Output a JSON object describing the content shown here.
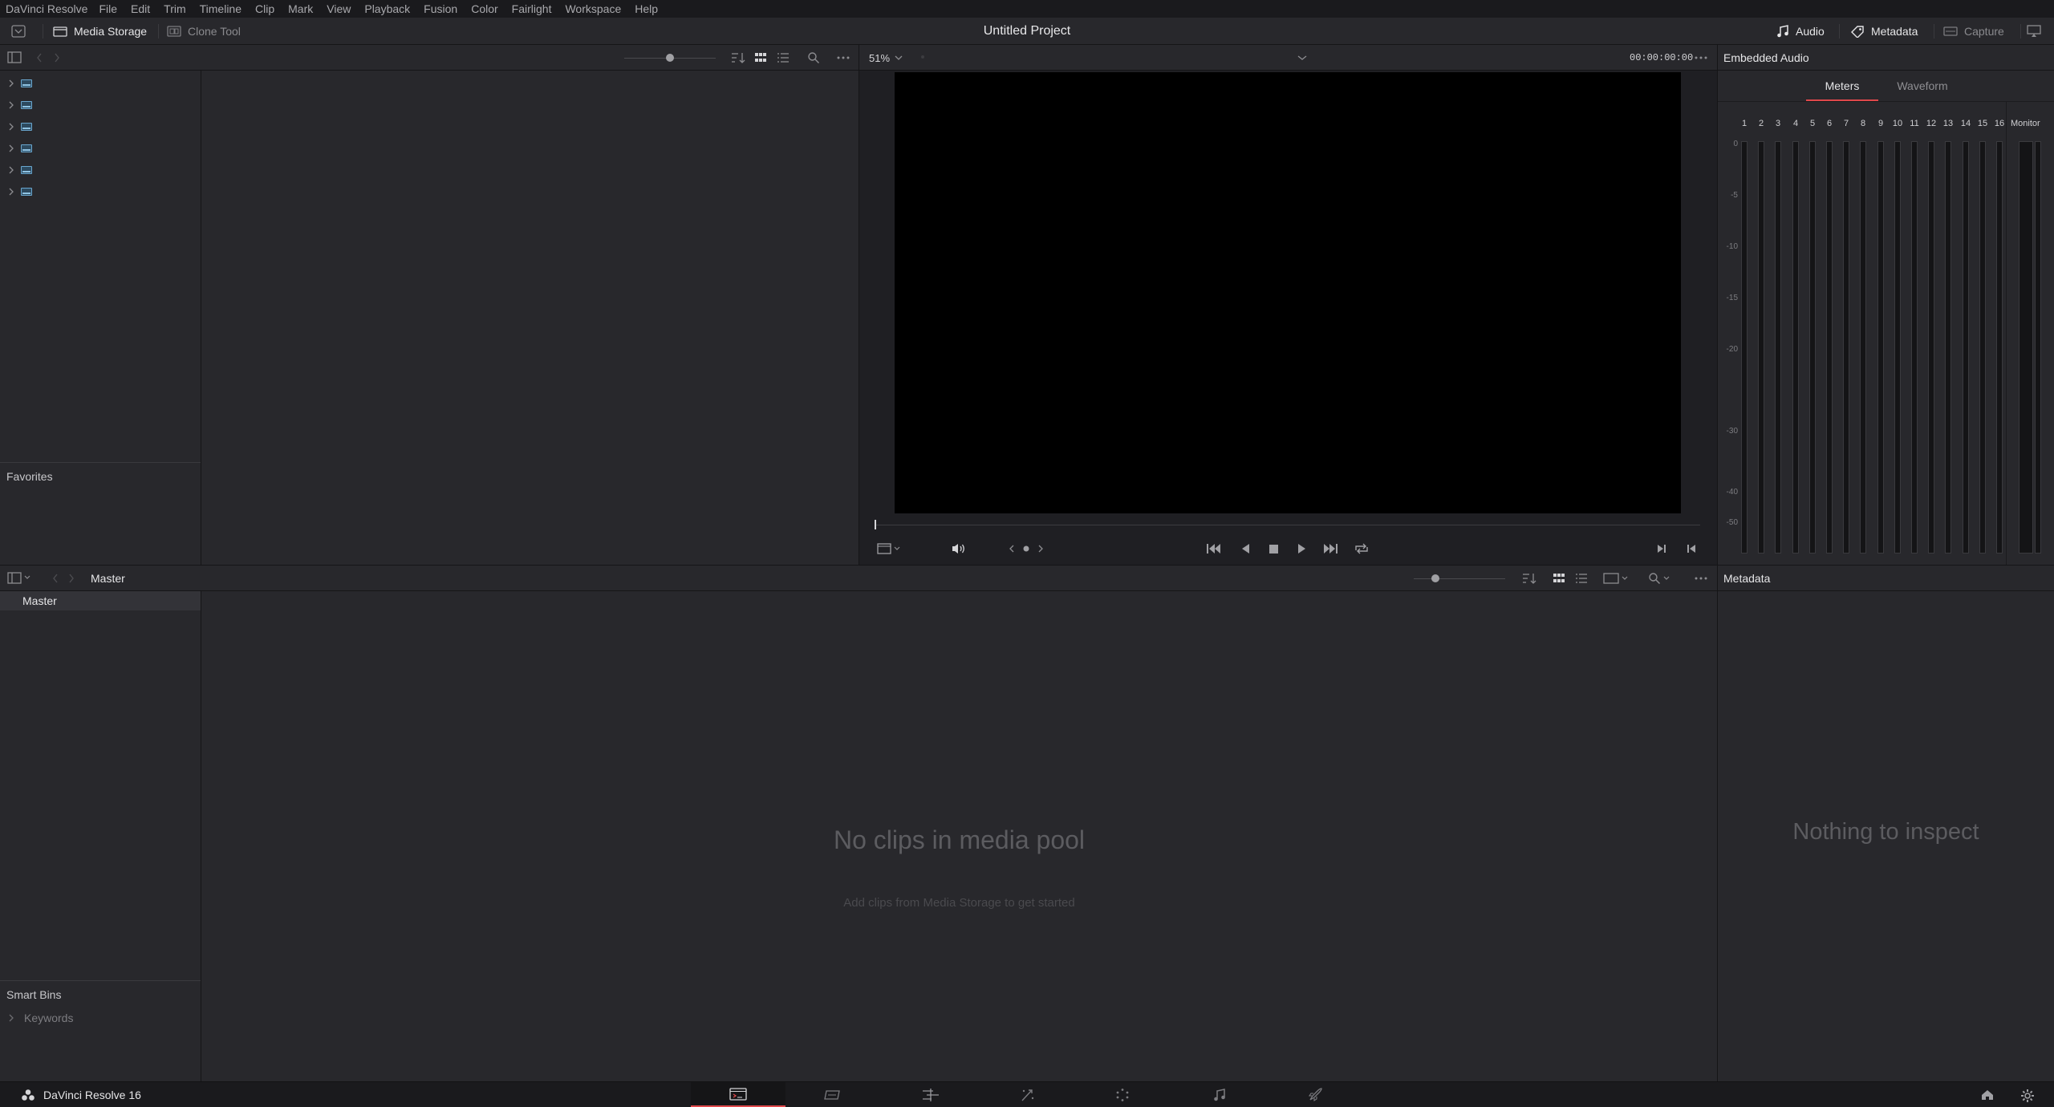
{
  "menu": [
    "DaVinci Resolve",
    "File",
    "Edit",
    "Trim",
    "Timeline",
    "Clip",
    "Mark",
    "View",
    "Playback",
    "Fusion",
    "Color",
    "Fairlight",
    "Workspace",
    "Help"
  ],
  "header": {
    "media_storage_label": "Media Storage",
    "clone_tool_label": "Clone Tool",
    "project_title": "Untitled Project",
    "audio_label": "Audio",
    "metadata_label": "Metadata",
    "capture_label": "Capture"
  },
  "storage": {
    "favorites_label": "Favorites",
    "drive_count": 6
  },
  "viewer": {
    "zoom": "51%",
    "timecode": "00:00:00:00"
  },
  "audio_panel": {
    "title": "Embedded Audio",
    "tabs": [
      "Meters",
      "Waveform"
    ],
    "active_tab": "Meters",
    "channels": [
      "1",
      "2",
      "3",
      "4",
      "5",
      "6",
      "7",
      "8",
      "9",
      "10",
      "11",
      "12",
      "13",
      "14",
      "15",
      "16"
    ],
    "monitor_label": "Monitor",
    "db_scale": [
      "0",
      "-5",
      "-10",
      "-15",
      "-20",
      "-30",
      "-40",
      "-50"
    ]
  },
  "media_pool": {
    "breadcrumb": "Master",
    "bin_master": "Master",
    "smart_bins_label": "Smart Bins",
    "keywords_label": "Keywords",
    "empty_title": "No clips in media pool",
    "empty_hint": "Add clips from Media Storage to get started"
  },
  "metadata_panel": {
    "title": "Metadata",
    "empty": "Nothing to inspect"
  },
  "footer": {
    "app_version": "DaVinci Resolve 16",
    "pages": [
      "media",
      "cut",
      "edit",
      "fusion",
      "color",
      "fairlight",
      "deliver"
    ],
    "active_page": "media"
  },
  "colors": {
    "accent": "#e0484b",
    "panel": "#28282c",
    "background": "#1f1f23"
  }
}
